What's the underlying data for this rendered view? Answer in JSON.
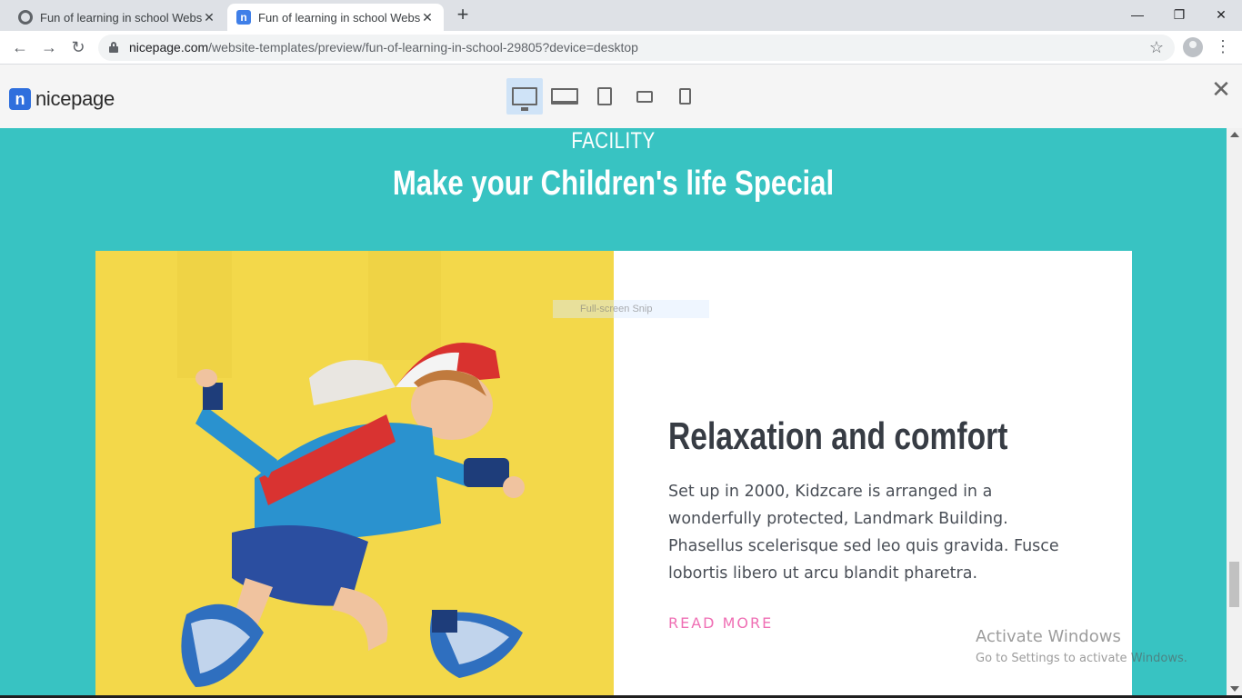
{
  "browser": {
    "tabs": [
      {
        "title": "Fun of learning in school Website",
        "active": false,
        "favicon": "globe-icon"
      },
      {
        "title": "Fun of learning in school Website",
        "active": true,
        "favicon": "nicepage-icon"
      }
    ],
    "new_tab_label": "+",
    "window_controls": {
      "minimize": "—",
      "maximize": "❐",
      "close": "✕"
    },
    "url_domain": "nicepage.com",
    "url_path": "/website-templates/preview/fun-of-learning-in-school-29805?device=desktop"
  },
  "nicepage_header": {
    "logo_mark": "n",
    "logo_text": "nicepage",
    "devices": [
      "desktop",
      "laptop",
      "tablet",
      "tablet-landscape",
      "phone"
    ],
    "active_device": "desktop",
    "close_label": "✕"
  },
  "section": {
    "kicker": "FACILITY",
    "title": "Make your Children's life Special"
  },
  "card": {
    "heading": "Relaxation and comfort",
    "body": "Set up in 2000, Kidzcare is arranged in a wonderfully protected, Landmark Building. Phasellus scelerisque sed leo quis gravida. Fusce lobortis libero ut arcu blandit pharetra.",
    "link": "READ MORE",
    "image_alt": "boy jumping"
  },
  "overlay": {
    "snip_text": "Full-screen Snip",
    "activate_title": "Activate Windows",
    "activate_subtitle": "Go to Settings to activate Windows."
  },
  "colors": {
    "section_bg": "#38c3c2",
    "image_bg": "#f3d84a",
    "link": "#ef6fb4",
    "heading": "#373c44"
  }
}
